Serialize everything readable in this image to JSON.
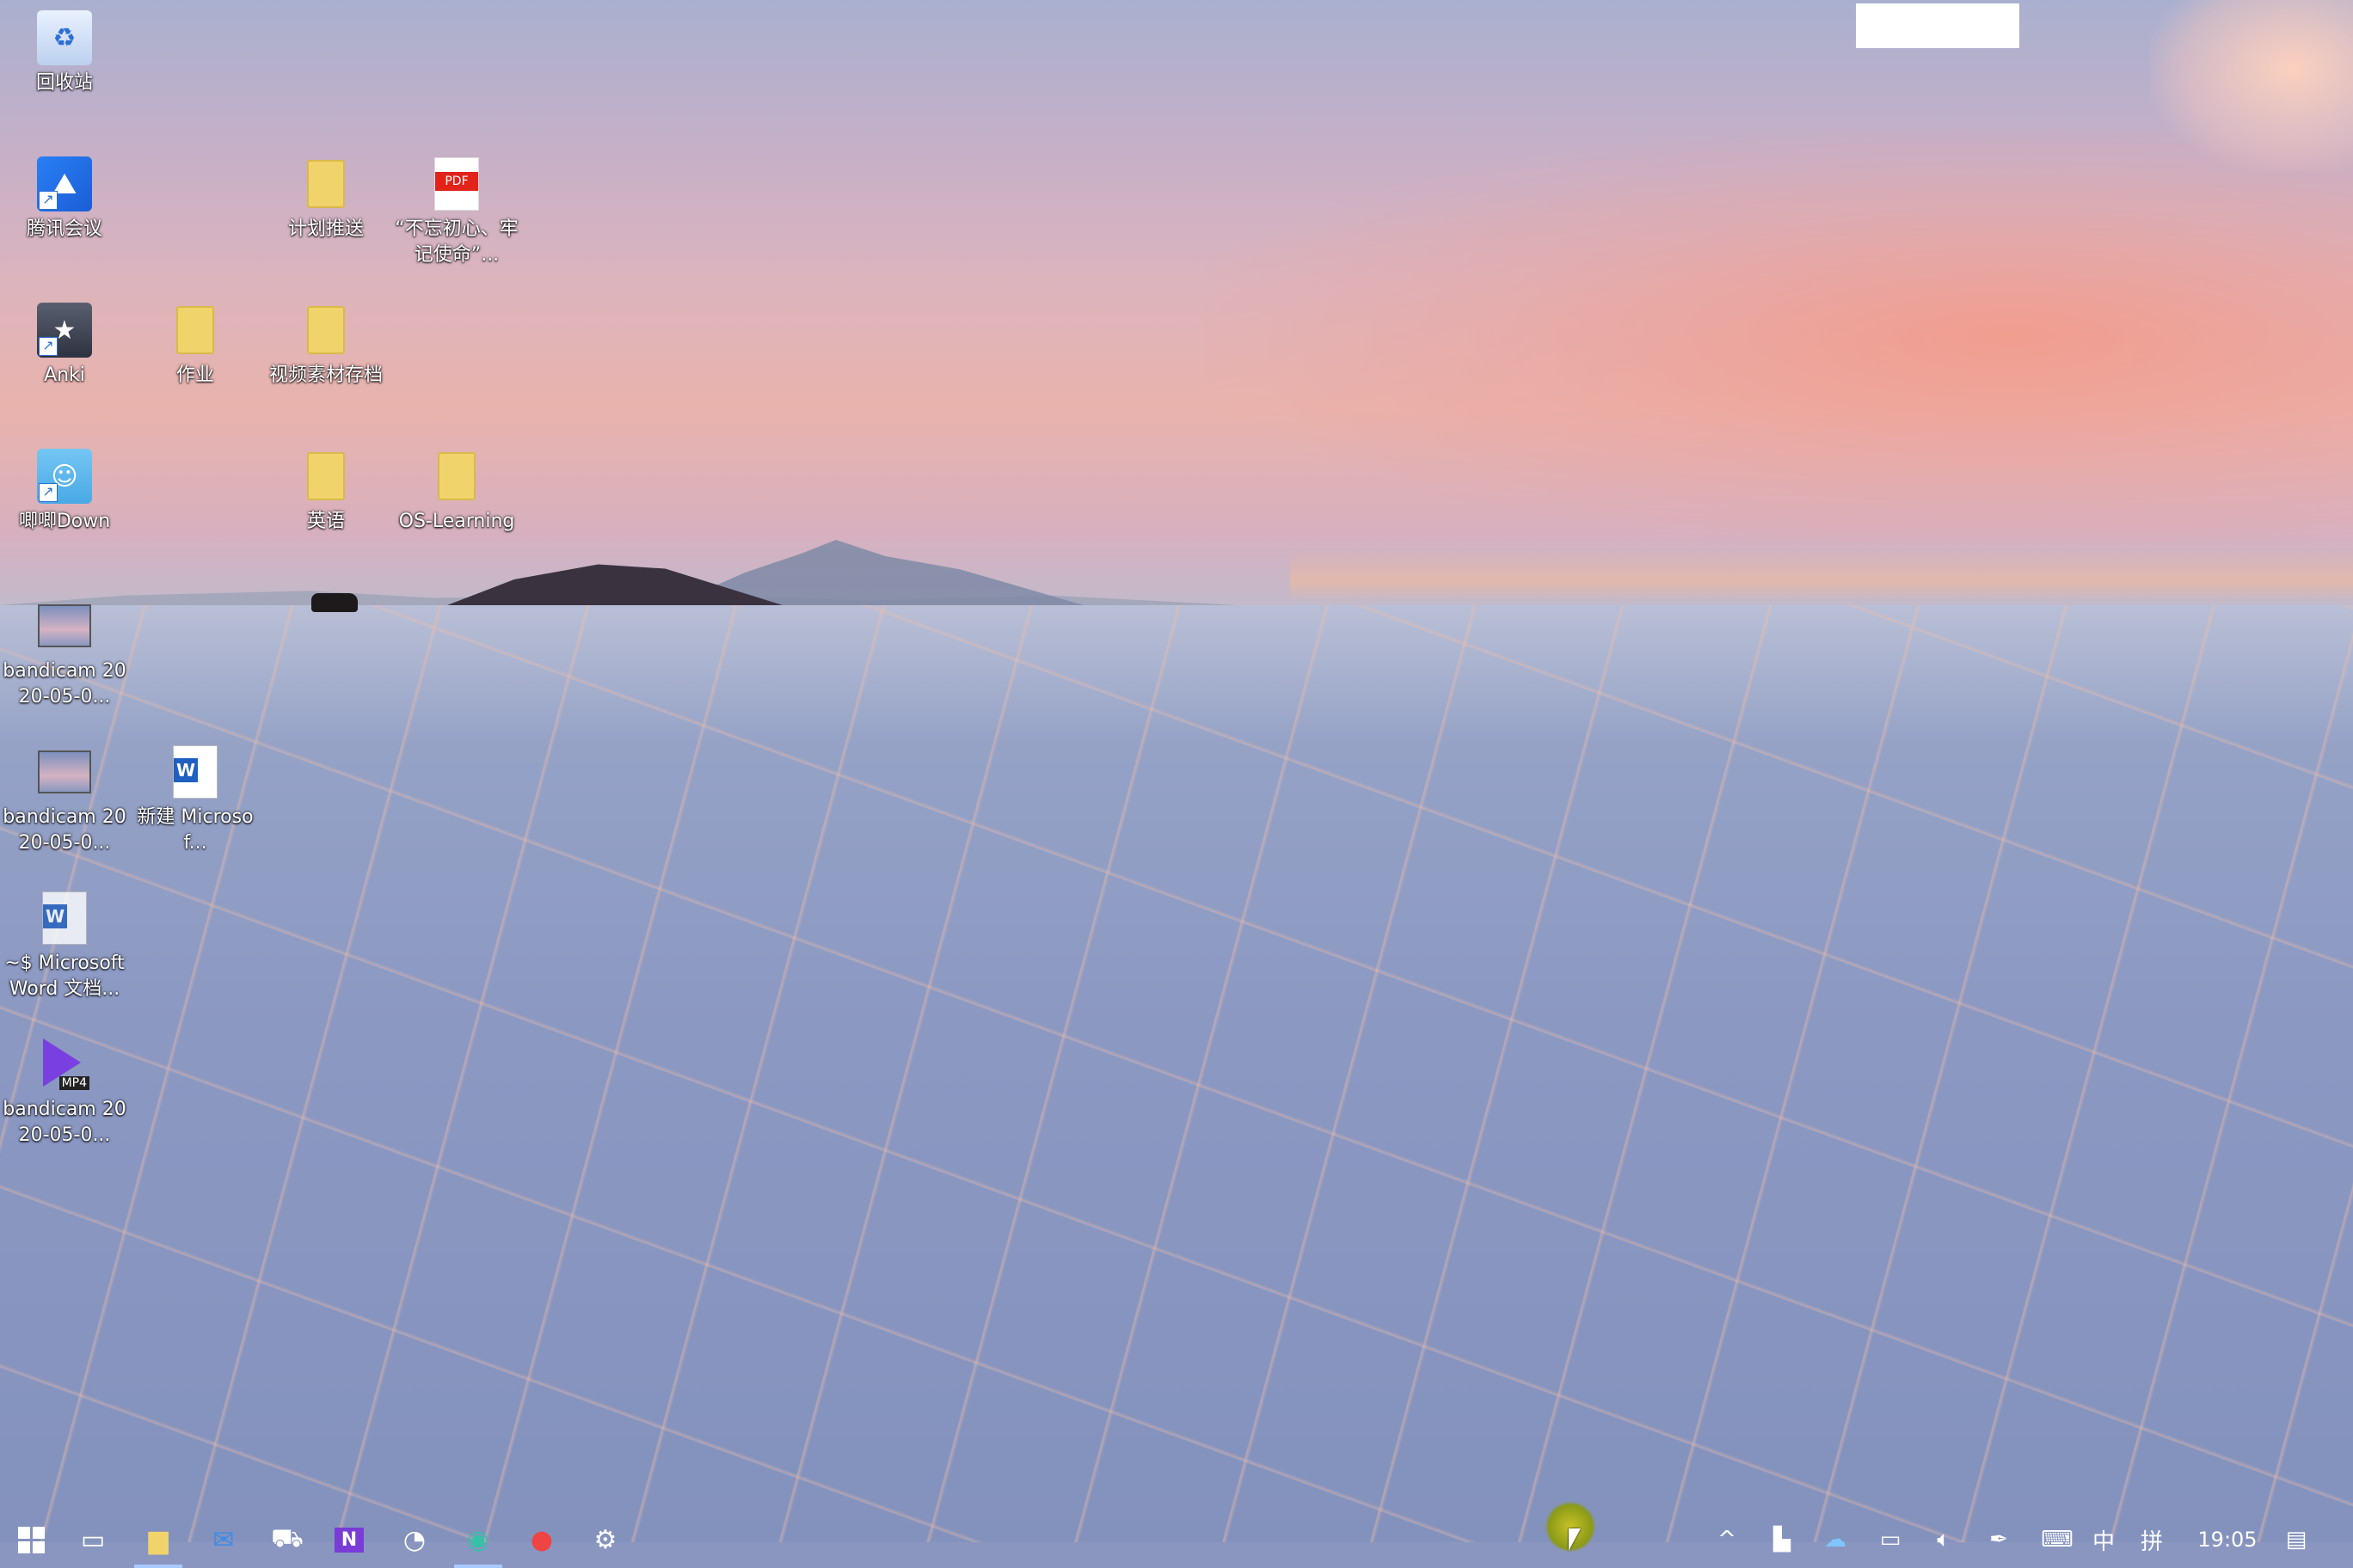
{
  "desktop": {
    "icons": [
      {
        "label": "回收站",
        "icon": "recycle-bin-icon"
      },
      {
        "label": "腾讯会议",
        "icon": "tencent-meeting-icon"
      },
      {
        "label": "计划推送",
        "icon": "folder-icon"
      },
      {
        "label": "“不忘初心、牢记使命”...",
        "icon": "pdf-file-icon"
      },
      {
        "label": "Anki",
        "icon": "anki-icon"
      },
      {
        "label": "作业",
        "icon": "folder-icon"
      },
      {
        "label": "视频素材存档",
        "icon": "folder-icon"
      },
      {
        "label": "唧唧Down",
        "icon": "jijidown-icon"
      },
      {
        "label": "英语",
        "icon": "folder-icon"
      },
      {
        "label": "OS-Learning",
        "icon": "folder-icon"
      },
      {
        "label": "bandicam 2020-05-0...",
        "icon": "video-thumbnail-icon"
      },
      {
        "label": "bandicam 2020-05-0...",
        "icon": "video-thumbnail-icon"
      },
      {
        "label": "新建 Microsof...",
        "icon": "word-document-icon"
      },
      {
        "label": "~$ Microsoft Word 文档...",
        "icon": "word-document-icon"
      },
      {
        "label": "bandicam 2020-05-0...",
        "icon": "mp4-file-icon"
      }
    ]
  },
  "taskbar": {
    "apps": [
      {
        "name": "start",
        "icon": "windows-logo-icon"
      },
      {
        "name": "task-view",
        "icon": "task-view-icon"
      },
      {
        "name": "file-explorer",
        "icon": "folder-icon"
      },
      {
        "name": "mail",
        "icon": "mail-icon"
      },
      {
        "name": "app-5",
        "icon": "app-icon"
      },
      {
        "name": "onenote",
        "icon": "onenote-icon"
      },
      {
        "name": "app-7",
        "icon": "app-icon"
      },
      {
        "name": "edge",
        "icon": "edge-icon"
      },
      {
        "name": "app-9",
        "icon": "app-icon"
      },
      {
        "name": "app-10",
        "icon": "app-icon"
      }
    ],
    "tray": {
      "ime_lang": "中",
      "ime_mode": "拼",
      "clock": "19:05"
    }
  }
}
